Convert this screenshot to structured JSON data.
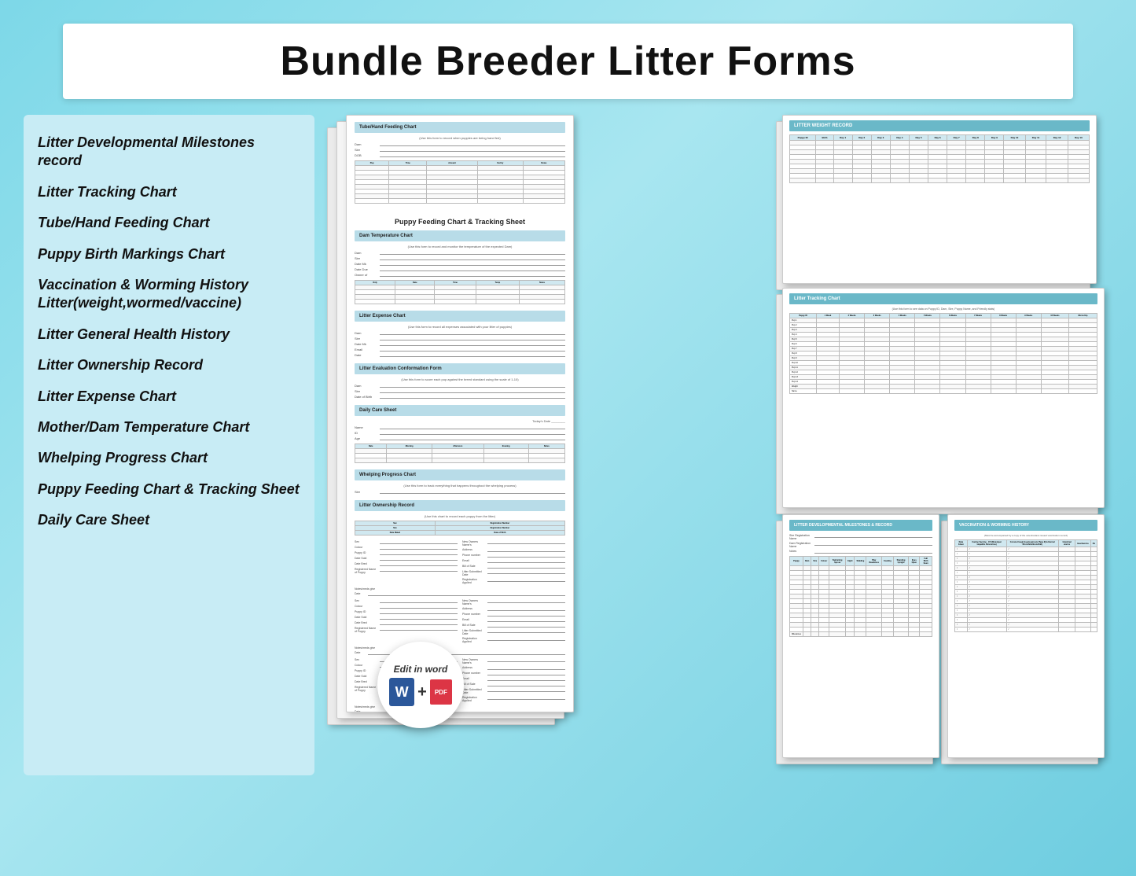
{
  "header": {
    "title": "Bundle Breeder Litter Forms"
  },
  "sidebar": {
    "items": [
      {
        "id": "litter-dev-milestones",
        "label": "Litter   Developmental   Milestones record"
      },
      {
        "id": "litter-tracking",
        "label": "Litter Tracking Chart"
      },
      {
        "id": "tube-hand-feeding",
        "label": "Tube/Hand Feeding Chart"
      },
      {
        "id": "puppy-birth-markings",
        "label": "Puppy Birth Markings Chart"
      },
      {
        "id": "vaccination-worming",
        "label": "Vaccination & Worming History Litter(weight,wormed/vaccine)"
      },
      {
        "id": "litter-general-health",
        "label": "Litter General Health History"
      },
      {
        "id": "litter-ownership",
        "label": "Litter Ownership Record"
      },
      {
        "id": "litter-expense",
        "label": "Litter Expense Chart"
      },
      {
        "id": "mother-dam-temp",
        "label": "Mother/Dam Temperature Chart"
      },
      {
        "id": "whelping-progress",
        "label": "Whelping Progress Chart"
      },
      {
        "id": "puppy-feeding",
        "label": "Puppy  Feeding  Chart  &  Tracking Sheet"
      },
      {
        "id": "daily-care",
        "label": "Daily Care Sheet"
      }
    ]
  },
  "edit_badge": {
    "text": "Edit in word",
    "word_label": "W",
    "pdf_label": "PDF",
    "plus": "+"
  },
  "docs": {
    "center_main": {
      "title": "Tube/Hand Feeding Chart",
      "subtitle": "Puppy Feeding Chart & Tracking Sheet",
      "dam_temp": "Dam Temperature Chart",
      "litter_expense": "Litter Expense Chart",
      "evaluation": "Litter Evaluation Conformation Form",
      "daily_care": "Daily Care Sheet",
      "whelping": "Whelping Progress Chart",
      "ownership": "Litter Ownership Record"
    },
    "right_top": {
      "title": "LITTER WEIGHT RECORD"
    },
    "right_mid": {
      "title": "Litter Tracking Chart"
    },
    "right_bottom_left": {
      "title": "LITTER DEVELOPMENTAL MILESTONES & RECORD"
    },
    "right_bottom_right": {
      "title": "VACCINATION & WORMING HISTORY"
    }
  }
}
